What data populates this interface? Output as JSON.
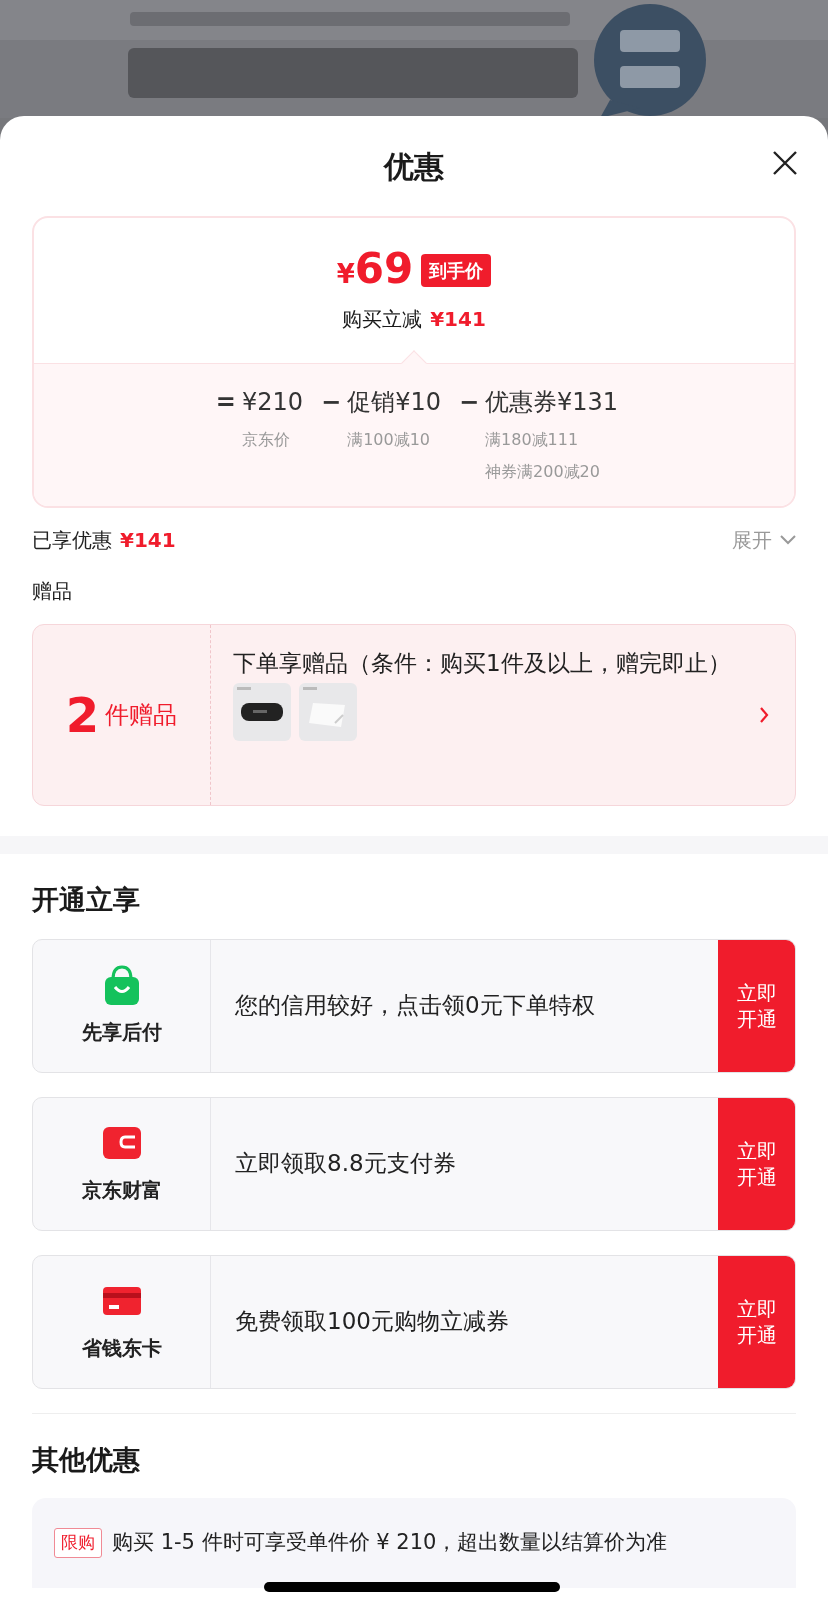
{
  "sheet": {
    "title": "优惠"
  },
  "summary": {
    "currency": "¥",
    "amount": "69",
    "tag": "到手价",
    "saving_label": "购买立减",
    "saving_amount": "¥141",
    "breakdown": [
      {
        "operator": "=",
        "value": "¥210",
        "notes": [
          "京东价"
        ]
      },
      {
        "operator": "−",
        "value": "促销¥10",
        "notes": [
          "满100减10"
        ]
      },
      {
        "operator": "−",
        "value": "优惠券¥131",
        "notes": [
          "满180减111",
          "神券满200减20"
        ]
      }
    ]
  },
  "enjoyed": {
    "label": "已享优惠",
    "amount": "¥141",
    "toggle": "展开"
  },
  "gifts": {
    "heading": "赠品",
    "count": "2",
    "unit": "件赠品",
    "description": "下单享赠品（条件：购买1件及以上，赠完即止）"
  },
  "activate": {
    "heading": "开通立享",
    "offers": [
      {
        "name": "先享后付",
        "text": "您的信用较好，点击领0元下单特权",
        "button": "立即开通"
      },
      {
        "name": "京东财富",
        "text": "立即领取8.8元支付券",
        "button": "立即开通"
      },
      {
        "name": "省钱东卡",
        "text": "免费领取100元购物立减券",
        "button": "立即开通"
      }
    ]
  },
  "other": {
    "heading": "其他优惠",
    "items": [
      {
        "tag": "限购",
        "text": "购买 1-5 件时可享受单件价 ¥ 210，超出数量以结算价为准"
      }
    ]
  }
}
